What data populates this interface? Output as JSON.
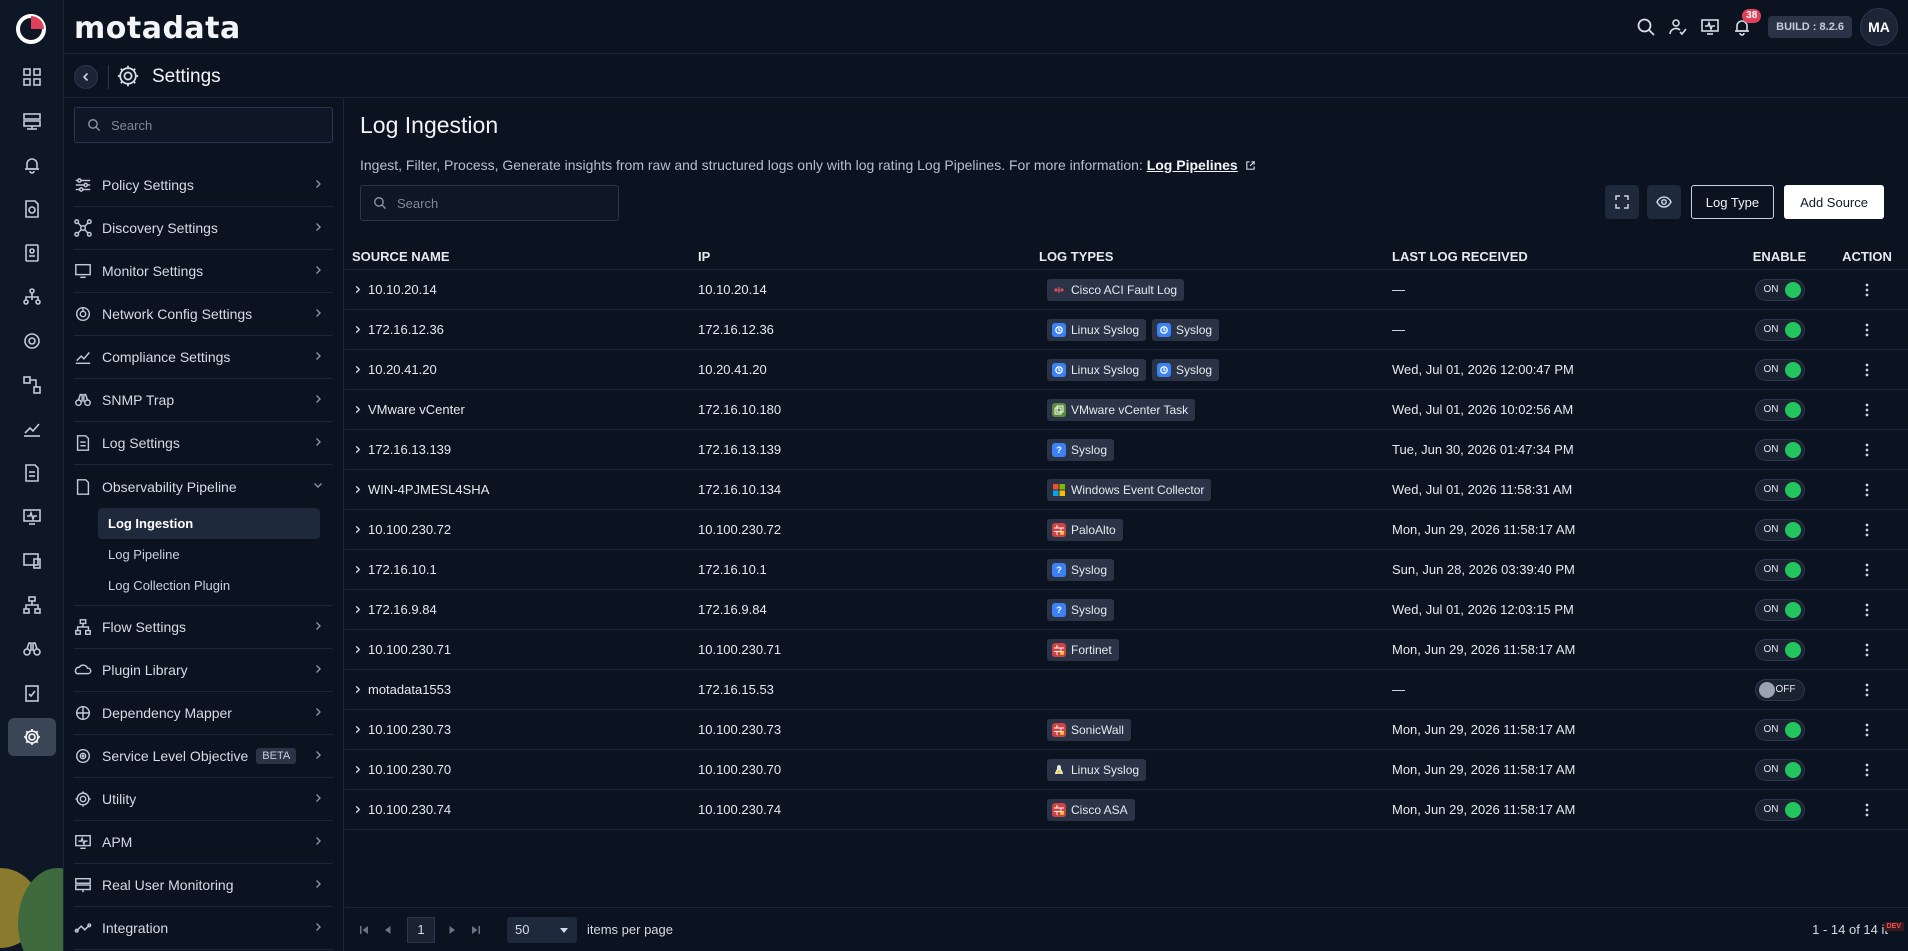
{
  "brand": "motadata",
  "topbar": {
    "notification_count": "38",
    "build": "BUILD : 8.2.6",
    "avatar_initials": "MA"
  },
  "settings_header": {
    "title": "Settings"
  },
  "sidebar": {
    "search_placeholder": "Search",
    "items": [
      {
        "label": "Policy Settings",
        "icon": "sliders-icon"
      },
      {
        "label": "Discovery Settings",
        "icon": "discovery-icon"
      },
      {
        "label": "Monitor Settings",
        "icon": "monitor-icon"
      },
      {
        "label": "Network Config Settings",
        "icon": "network-config-icon"
      },
      {
        "label": "Compliance Settings",
        "icon": "compliance-icon"
      },
      {
        "label": "SNMP Trap",
        "icon": "binoculars-icon"
      },
      {
        "label": "Log Settings",
        "icon": "log-icon"
      },
      {
        "label": "Observability Pipeline",
        "icon": "pipeline-icon"
      }
    ],
    "sub_items": [
      "Log Ingestion",
      "Log Pipeline",
      "Log Collection Plugin"
    ],
    "items_after": [
      {
        "label": "Flow Settings",
        "icon": "flow-icon"
      },
      {
        "label": "Plugin Library",
        "icon": "plugin-icon"
      },
      {
        "label": "Dependency Mapper",
        "icon": "dependency-icon"
      },
      {
        "label": "Service Level Objective",
        "icon": "slo-icon",
        "badge": "BETA"
      },
      {
        "label": "Utility",
        "icon": "utility-gear-icon"
      },
      {
        "label": "APM",
        "icon": "apm-icon"
      },
      {
        "label": "Real User Monitoring",
        "icon": "rum-icon"
      },
      {
        "label": "Integration",
        "icon": "integration-icon"
      }
    ]
  },
  "main": {
    "title": "Log Ingestion",
    "description": "Ingest, Filter, Process, Generate insights from raw and structured logs only with log rating Log Pipelines. For more information: ",
    "link": "Log Pipelines",
    "search_placeholder": "Search",
    "buttons": {
      "log_type": "Log Type",
      "add_source": "Add Source"
    }
  },
  "table": {
    "headers": [
      "SOURCE NAME",
      "IP",
      "LOG TYPES",
      "LAST LOG RECEIVED",
      "ENABLE",
      "ACTION"
    ],
    "rows": [
      {
        "name": "10.10.20.14",
        "ip": "10.10.20.14",
        "tags": [
          {
            "label": "Cisco ACI Fault Log",
            "icon": "cisco"
          }
        ],
        "last": "—",
        "enabled": "ON"
      },
      {
        "name": "172.16.12.36",
        "ip": "172.16.12.36",
        "tags": [
          {
            "label": "Linux Syslog",
            "icon": "syslog"
          },
          {
            "label": "Syslog",
            "icon": "syslog"
          }
        ],
        "last": "—",
        "enabled": "ON"
      },
      {
        "name": "10.20.41.20",
        "ip": "10.20.41.20",
        "tags": [
          {
            "label": "Linux Syslog",
            "icon": "syslog"
          },
          {
            "label": "Syslog",
            "icon": "syslog"
          }
        ],
        "last": "Wed, Jul 01, 2026 12:00:47 PM",
        "enabled": "ON"
      },
      {
        "name": "VMware vCenter",
        "ip": "172.16.10.180",
        "tags": [
          {
            "label": "VMware vCenter Task",
            "icon": "vm"
          }
        ],
        "last": "Wed, Jul 01, 2026 10:02:56 AM",
        "enabled": "ON"
      },
      {
        "name": "172.16.13.139",
        "ip": "172.16.13.139",
        "tags": [
          {
            "label": "Syslog",
            "icon": "question"
          }
        ],
        "last": "Tue, Jun 30, 2026 01:47:34 PM",
        "enabled": "ON"
      },
      {
        "name": "WIN-4PJMESL4SHA",
        "ip": "172.16.10.134",
        "tags": [
          {
            "label": "Windows Event Collector",
            "icon": "windows"
          }
        ],
        "last": "Wed, Jul 01, 2026 11:58:31 AM",
        "enabled": "ON"
      },
      {
        "name": "10.100.230.72",
        "ip": "10.100.230.72",
        "tags": [
          {
            "label": "PaloAlto",
            "icon": "firewall"
          }
        ],
        "last": "Mon, Jun 29, 2026 11:58:17 AM",
        "enabled": "ON"
      },
      {
        "name": "172.16.10.1",
        "ip": "172.16.10.1",
        "tags": [
          {
            "label": "Syslog",
            "icon": "question"
          }
        ],
        "last": "Sun, Jun 28, 2026 03:39:40 PM",
        "enabled": "ON"
      },
      {
        "name": "172.16.9.84",
        "ip": "172.16.9.84",
        "tags": [
          {
            "label": "Syslog",
            "icon": "question"
          }
        ],
        "last": "Wed, Jul 01, 2026 12:03:15 PM",
        "enabled": "ON"
      },
      {
        "name": "10.100.230.71",
        "ip": "10.100.230.71",
        "tags": [
          {
            "label": "Fortinet",
            "icon": "firewall"
          }
        ],
        "last": "Mon, Jun 29, 2026 11:58:17 AM",
        "enabled": "ON"
      },
      {
        "name": "motadata1553",
        "ip": "172.16.15.53",
        "tags": [],
        "last": "—",
        "enabled": "OFF"
      },
      {
        "name": "10.100.230.73",
        "ip": "10.100.230.73",
        "tags": [
          {
            "label": "SonicWall",
            "icon": "firewall"
          }
        ],
        "last": "Mon, Jun 29, 2026 11:58:17 AM",
        "enabled": "ON"
      },
      {
        "name": "10.100.230.70",
        "ip": "10.100.230.70",
        "tags": [
          {
            "label": "Linux Syslog",
            "icon": "linux"
          }
        ],
        "last": "Mon, Jun 29, 2026 11:58:17 AM",
        "enabled": "ON"
      },
      {
        "name": "10.100.230.74",
        "ip": "10.100.230.74",
        "tags": [
          {
            "label": "Cisco ASA",
            "icon": "firewall"
          }
        ],
        "last": "Mon, Jun 29, 2026 11:58:17 AM",
        "enabled": "ON"
      }
    ]
  },
  "pagination": {
    "page": "1",
    "per_page": "50",
    "items_per_page_label": "items per page",
    "range": "1 - 14 of 14 it",
    "env_badge": "DEV"
  }
}
